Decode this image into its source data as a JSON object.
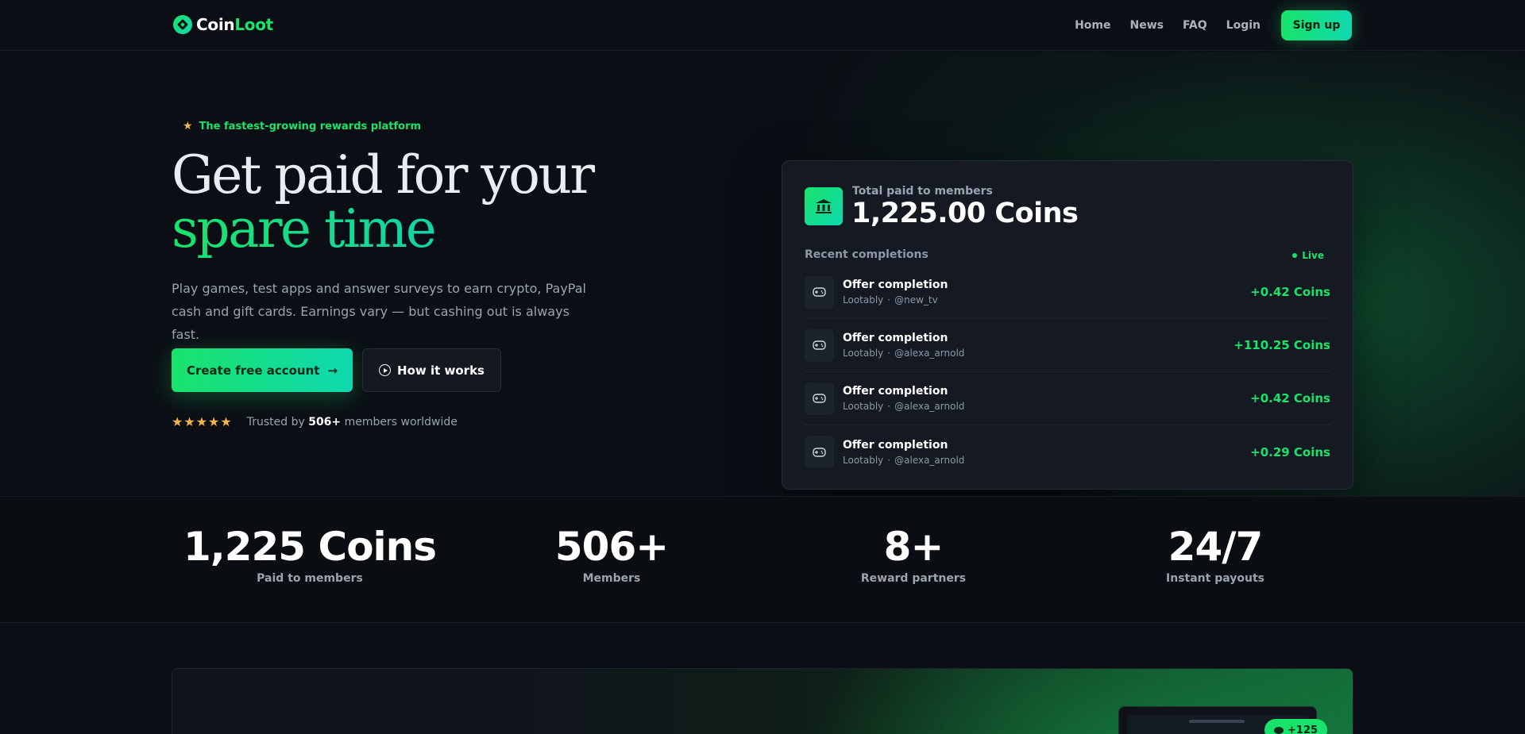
{
  "brand": {
    "name_part1": "Coin",
    "name_part2": "Loot"
  },
  "nav": {
    "links": [
      "Home",
      "News",
      "FAQ",
      "Login"
    ],
    "signup_label": "Sign up"
  },
  "hero": {
    "badge": "The fastest-growing rewards platform",
    "headline_plain": "Get paid for your ",
    "headline_accent": "spare time",
    "subtext": "Play games, test apps and answer surveys to earn crypto, PayPal cash and gift cards. Earnings vary — but cashing out is always fast.",
    "primary_button": "Create free account",
    "secondary_button": "How it works",
    "stars": "★★★★★",
    "trust_prefix": "Trusted by ",
    "trust_count": "506+",
    "trust_suffix": " members worldwide"
  },
  "panel": {
    "paid_label": "Total paid to members",
    "paid_value": "1,225.00 Coins",
    "recent_label": "Recent completions",
    "live_label": "Live",
    "rows": [
      {
        "title": "Offer completion",
        "source": "Lootably",
        "user": "@new_tv",
        "amount": "+0.42 Coins"
      },
      {
        "title": "Offer completion",
        "source": "Lootably",
        "user": "@alexa_arnold",
        "amount": "+110.25 Coins"
      },
      {
        "title": "Offer completion",
        "source": "Lootably",
        "user": "@alexa_arnold",
        "amount": "+0.42 Coins"
      },
      {
        "title": "Offer completion",
        "source": "Lootably",
        "user": "@alexa_arnold",
        "amount": "+0.29 Coins"
      }
    ]
  },
  "stats": [
    {
      "value": "1,225 Coins",
      "label": "Paid to members"
    },
    {
      "value": "506+",
      "label": "Members"
    },
    {
      "value": "8+",
      "label": "Reward partners"
    },
    {
      "value": "24/7",
      "label": "Instant payouts"
    }
  ],
  "preview": {
    "coin_pill": "+125"
  },
  "colors": {
    "accent": "#19e36a",
    "accent2": "#0fd8b0",
    "star": "#f3b34c",
    "background": "#0b0f15"
  }
}
